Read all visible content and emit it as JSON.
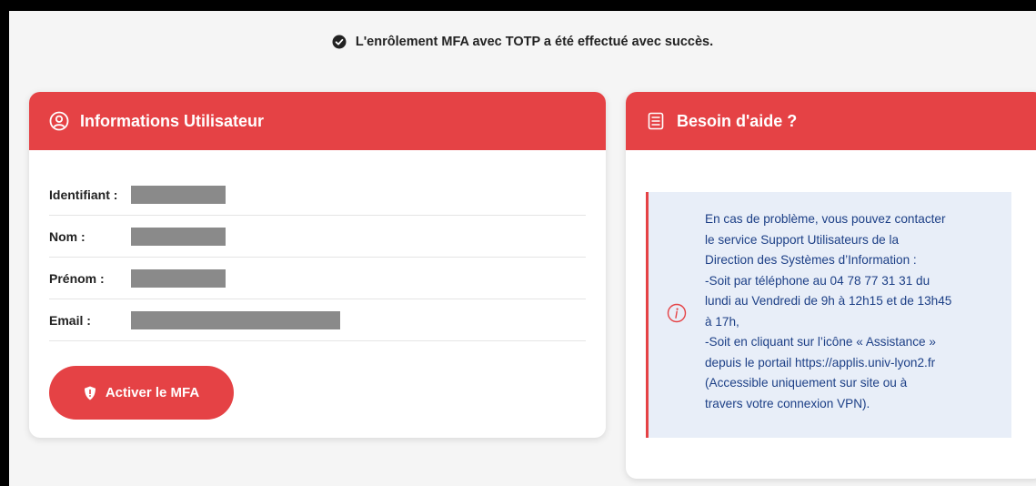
{
  "banner": {
    "message": "L'enrôlement MFA avec TOTP a été effectué avec succès.",
    "icon": "check-circle-icon"
  },
  "user_card": {
    "title": "Informations Utilisateur",
    "icon": "user-circle-icon",
    "fields": [
      {
        "label": "Identifiant :",
        "value_redacted": true
      },
      {
        "label": "Nom :",
        "value_redacted": true
      },
      {
        "label": "Prénom :",
        "value_redacted": true
      },
      {
        "label": "Email :",
        "value_redacted": true
      }
    ],
    "button_label": "Activer le MFA",
    "button_icon": "shield-icon"
  },
  "help_card": {
    "title": "Besoin d'aide ?",
    "icon": "document-list-icon",
    "info_icon": "info-icon",
    "lines": [
      "En cas de problème, vous pouvez contacter",
      "le service Support Utilisateurs de la",
      "Direction des Systèmes d’Information :",
      "-Soit par téléphone au 04 78 77 31 31 du",
      "lundi au Vendredi de 9h à 12h15 et de 13h45",
      "à 17h,",
      "-Soit en cliquant sur l’icône « Assistance »",
      "depuis le portail https://applis.univ-lyon2.fr",
      "(Accessible uniquement sur site ou à",
      "travers votre connexion VPN)."
    ]
  },
  "colors": {
    "accent": "#e54245",
    "info_bg": "#e8eef8",
    "info_text": "#1c3f86",
    "redaction": "#8a8a8a"
  }
}
